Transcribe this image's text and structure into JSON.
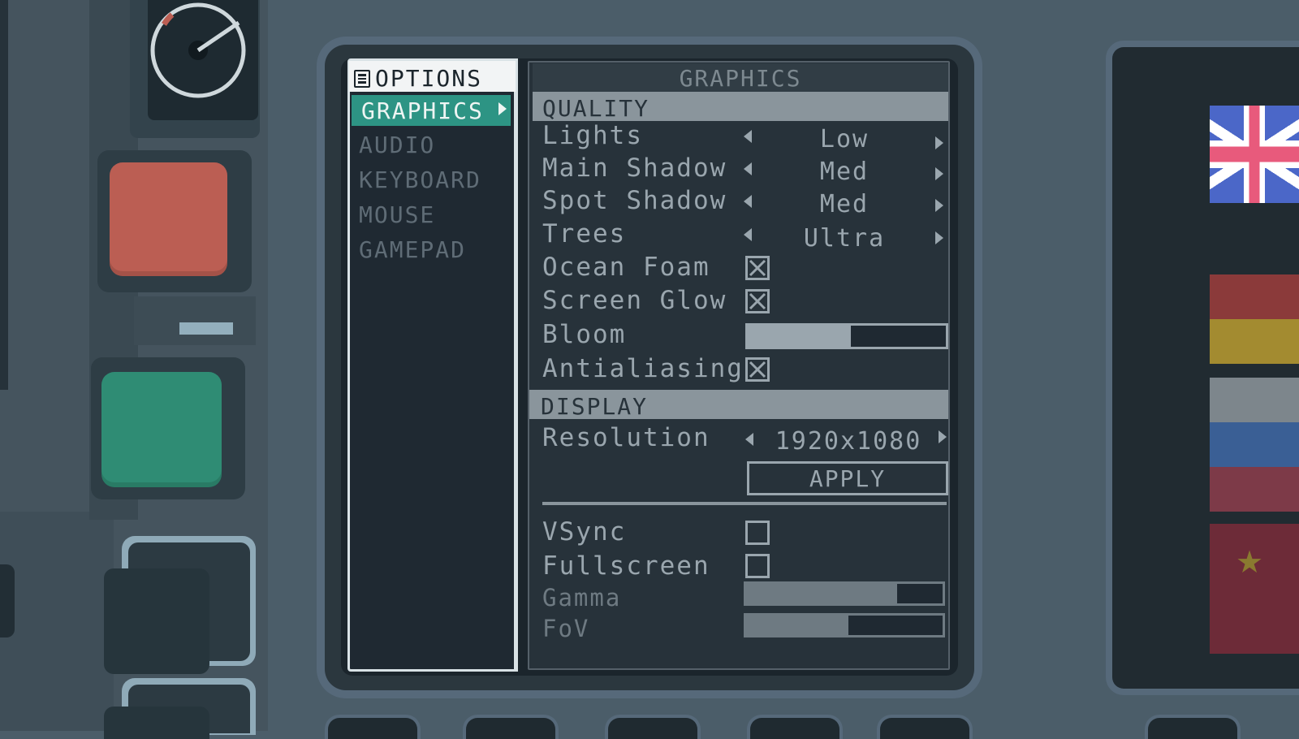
{
  "menu": {
    "header": "OPTIONS",
    "items": [
      {
        "label": "GRAPHICS",
        "selected": true
      },
      {
        "label": "AUDIO",
        "selected": false
      },
      {
        "label": "KEYBOARD",
        "selected": false
      },
      {
        "label": "MOUSE",
        "selected": false
      },
      {
        "label": "GAMEPAD",
        "selected": false
      }
    ]
  },
  "settings": {
    "title": "GRAPHICS",
    "quality": {
      "section_label": "QUALITY",
      "lights": {
        "label": "Lights",
        "value": "Low"
      },
      "main_shadow": {
        "label": "Main Shadow",
        "value": "Med"
      },
      "spot_shadow": {
        "label": "Spot Shadow",
        "value": "Med"
      },
      "trees": {
        "label": "Trees",
        "value": "Ultra"
      },
      "ocean_foam": {
        "label": "Ocean Foam",
        "checked": true
      },
      "screen_glow": {
        "label": "Screen Glow",
        "checked": true
      },
      "bloom": {
        "label": "Bloom",
        "level": 0.52
      },
      "antialiasing": {
        "label": "Antialiasing",
        "checked": true
      }
    },
    "display": {
      "section_label": "DISPLAY",
      "resolution": {
        "label": "Resolution",
        "value": "1920x1080"
      },
      "apply_label": "APPLY",
      "vsync": {
        "label": "VSync",
        "checked": false
      },
      "fullscreen": {
        "label": "Fullscreen",
        "checked": false
      },
      "gamma": {
        "label": "Gamma",
        "level": 0.77
      },
      "fov": {
        "label": "FoV",
        "level": 0.52
      }
    }
  },
  "flags": [
    "uk-flag",
    "germany-flag",
    "russia-flag",
    "china-flag"
  ],
  "colors": {
    "accent": "#2d9484",
    "crt_text": "#9aa6ae",
    "red_button": "#bb5e53",
    "green_button": "#2f8c74"
  }
}
